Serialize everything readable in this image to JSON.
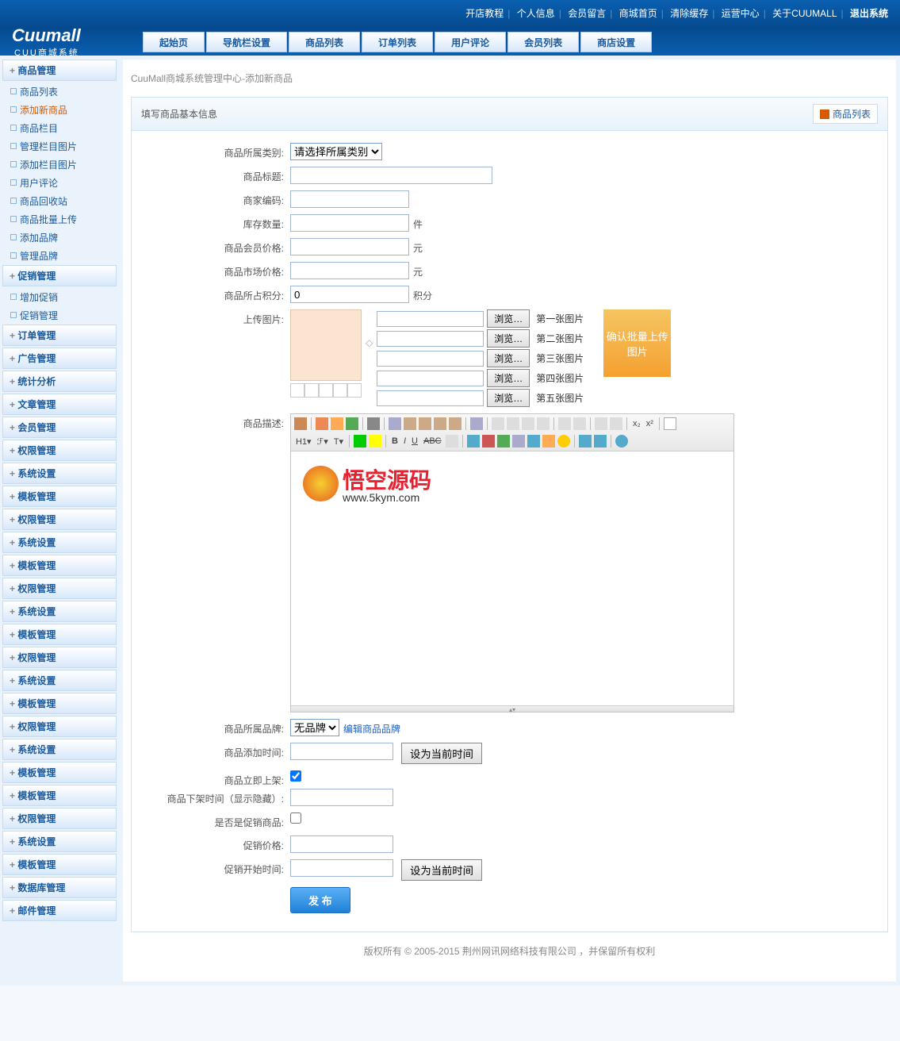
{
  "header": {
    "links": [
      "开店教程",
      "个人信息",
      "会员留言",
      "商城首页",
      "清除缓存",
      "运营中心",
      "关于CUUMALL"
    ],
    "logout": "退出系统"
  },
  "logo": {
    "main": "Cuumall",
    "sub": "CUU商城系统"
  },
  "nav": [
    "起始页",
    "导航栏设置",
    "商品列表",
    "订单列表",
    "用户评论",
    "会员列表",
    "商店设置"
  ],
  "sidebar": [
    {
      "label": "商品管理",
      "type": "h"
    },
    {
      "label": "商品列表",
      "type": "i"
    },
    {
      "label": "添加新商品",
      "type": "i",
      "active": true
    },
    {
      "label": "商品栏目",
      "type": "i"
    },
    {
      "label": "管理栏目图片",
      "type": "i"
    },
    {
      "label": "添加栏目图片",
      "type": "i"
    },
    {
      "label": "用户评论",
      "type": "i"
    },
    {
      "label": "商品回收站",
      "type": "i"
    },
    {
      "label": "商品批量上传",
      "type": "i"
    },
    {
      "label": "添加品牌",
      "type": "i"
    },
    {
      "label": "管理品牌",
      "type": "i"
    },
    {
      "label": "促销管理",
      "type": "h"
    },
    {
      "label": "增加促销",
      "type": "i"
    },
    {
      "label": "促销管理",
      "type": "i"
    },
    {
      "label": "订单管理",
      "type": "h"
    },
    {
      "label": "广告管理",
      "type": "h"
    },
    {
      "label": "统计分析",
      "type": "h"
    },
    {
      "label": "文章管理",
      "type": "h"
    },
    {
      "label": "会员管理",
      "type": "h"
    },
    {
      "label": "权限管理",
      "type": "h"
    },
    {
      "label": "系统设置",
      "type": "h"
    },
    {
      "label": "模板管理",
      "type": "h"
    },
    {
      "label": "权限管理",
      "type": "h"
    },
    {
      "label": "系统设置",
      "type": "h"
    },
    {
      "label": "模板管理",
      "type": "h"
    },
    {
      "label": "权限管理",
      "type": "h"
    },
    {
      "label": "系统设置",
      "type": "h"
    },
    {
      "label": "模板管理",
      "type": "h"
    },
    {
      "label": "权限管理",
      "type": "h"
    },
    {
      "label": "系统设置",
      "type": "h"
    },
    {
      "label": "模板管理",
      "type": "h"
    },
    {
      "label": "权限管理",
      "type": "h"
    },
    {
      "label": "系统设置",
      "type": "h"
    },
    {
      "label": "模板管理",
      "type": "h"
    },
    {
      "label": "模板管理",
      "type": "h"
    },
    {
      "label": "权限管理",
      "type": "h"
    },
    {
      "label": "系统设置",
      "type": "h"
    },
    {
      "label": "模板管理",
      "type": "h"
    },
    {
      "label": "数据库管理",
      "type": "h"
    },
    {
      "label": "邮件管理",
      "type": "h"
    }
  ],
  "breadcrumb": "CuuMall商城系统管理中心-添加新商品",
  "panel": {
    "title": "填写商品基本信息",
    "list_btn": "商品列表"
  },
  "form": {
    "category": {
      "label": "商品所属类别:",
      "placeholder": "请选择所属类别"
    },
    "title": {
      "label": "商品标题:"
    },
    "code": {
      "label": "商家编码:"
    },
    "stock": {
      "label": "库存数量:",
      "suffix": "件"
    },
    "member_price": {
      "label": "商品会员价格:",
      "suffix": "元"
    },
    "market_price": {
      "label": "商品市场价格:",
      "suffix": "元"
    },
    "points": {
      "label": "商品所占积分:",
      "value": "0",
      "suffix": "积分"
    },
    "upload": {
      "label": "上传图片:",
      "browse": "浏览…",
      "items": [
        "第一张图片",
        "第二张图片",
        "第三张图片",
        "第四张图片",
        "第五张图片"
      ],
      "confirm": "确认批量上传图片"
    },
    "desc": {
      "label": "商品描述:"
    },
    "brand": {
      "label": "商品所属品牌:",
      "value": "无品牌",
      "edit": "编辑商品品牌"
    },
    "add_time": {
      "label": "商品添加时间:",
      "btn": "设为当前时间"
    },
    "on_shelf": {
      "label": "商品立即上架:"
    },
    "off_time": {
      "label": "商品下架时间（显示隐藏）:"
    },
    "is_promo": {
      "label": "是否是促销商品:"
    },
    "promo_price": {
      "label": "促销价格:"
    },
    "promo_start": {
      "label": "促销开始时间:",
      "btn": "设为当前时间"
    },
    "submit": "发 布"
  },
  "editor": {
    "watermark": {
      "text": "悟空源码",
      "url": "www.5kym.com"
    },
    "h1": "H1▾",
    "font": "ℱ▾",
    "size": "T▾"
  },
  "footer": "版权所有 © 2005-2015 荆州网讯网络科技有限公司  ，并保留所有权利"
}
